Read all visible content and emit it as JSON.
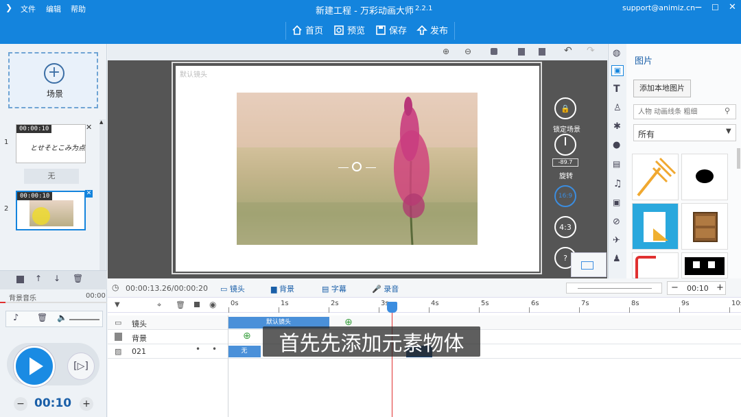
{
  "window": {
    "title": "新建工程 - 万彩动画大师",
    "version": "2.2.1",
    "account": "support@animiz.cn"
  },
  "menu": [
    "文件",
    "编辑",
    "帮助"
  ],
  "toolbar": {
    "home": "首页",
    "preview": "预览",
    "save": "保存",
    "publish": "发布"
  },
  "left": {
    "add_scene": "场景",
    "scenes": [
      {
        "index": "1",
        "time": "00:00:10",
        "thumb_text": "とせそとこみ为点"
      },
      {
        "index": "2",
        "time": "00:00:10"
      }
    ],
    "transition": "无",
    "bg_music_label": "背景音乐",
    "bg_music_time": "00:00",
    "duration": "00:10"
  },
  "canvas": {
    "camera_label": "默认镜头",
    "lock_scene": "锁定场景",
    "rotate_value": "-89.7",
    "rotate_label": "旋转",
    "ratio_169": "16:9",
    "ratio_43": "4:3",
    "help": "?"
  },
  "right_panel": {
    "title": "图片",
    "add_local": "添加本地图片",
    "search_placeholder": "人物 动画线条 粗细",
    "category": "所有"
  },
  "timeline": {
    "time_display": "00:00:13.26/00:00:20",
    "tabs": [
      "镜头",
      "背景",
      "字幕",
      "录音"
    ],
    "zoom_value": "00:10",
    "ruler": [
      "0s",
      "1s",
      "2s",
      "3s",
      "4s",
      "5s",
      "6s",
      "7s",
      "8s",
      "9s",
      "10s"
    ],
    "rows": [
      {
        "label": "镜头",
        "block": "默认镜头"
      },
      {
        "label": "背景"
      },
      {
        "label": "021",
        "block": "无"
      }
    ]
  },
  "subtitle": "首先先添加元素物体",
  "colors": {
    "brand": "#1484dd",
    "canvas_bg": "#555555",
    "playhead": "#e03030"
  }
}
